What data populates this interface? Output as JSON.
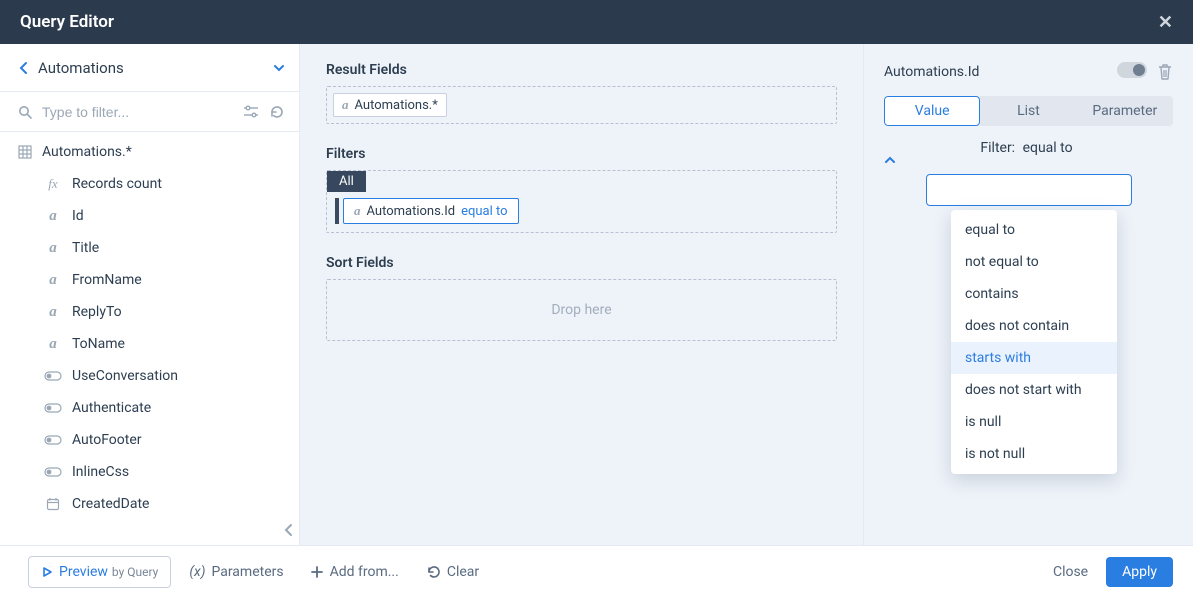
{
  "titlebar": {
    "title": "Query Editor"
  },
  "sidebar": {
    "breadcrumb": "Automations",
    "filter_placeholder": "Type to filter...",
    "root_label": "Automations.*",
    "fields": [
      {
        "icon": "fx",
        "label": "Records count"
      },
      {
        "icon": "a",
        "label": "Id"
      },
      {
        "icon": "a",
        "label": "Title"
      },
      {
        "icon": "a",
        "label": "FromName"
      },
      {
        "icon": "a",
        "label": "ReplyTo"
      },
      {
        "icon": "a",
        "label": "ToName"
      },
      {
        "icon": "tog",
        "label": "UseConversation"
      },
      {
        "icon": "tog",
        "label": "Authenticate"
      },
      {
        "icon": "tog",
        "label": "AutoFooter"
      },
      {
        "icon": "tog",
        "label": "InlineCss"
      },
      {
        "icon": "cal",
        "label": "CreatedDate"
      }
    ]
  },
  "center": {
    "result_fields_label": "Result Fields",
    "result_chip": "Automations.*",
    "filters_label": "Filters",
    "filters_all": "All",
    "filter_field": "Automations.Id",
    "filter_op": "equal to",
    "sort_label": "Sort Fields",
    "drop_here": "Drop here"
  },
  "right": {
    "field_name": "Automations.Id",
    "tabs": {
      "value": "Value",
      "list": "List",
      "parameter": "Parameter"
    },
    "filter_label": "Filter:",
    "filter_current": "equal to",
    "dropdown": [
      "equal to",
      "not equal to",
      "contains",
      "does not contain",
      "starts with",
      "does not start with",
      "is null",
      "is not null"
    ],
    "dropdown_hover_index": 4
  },
  "footer": {
    "preview": "Preview",
    "preview_sub": "by Query",
    "parameters": "Parameters",
    "add_from": "Add from...",
    "clear": "Clear",
    "close": "Close",
    "apply": "Apply"
  }
}
